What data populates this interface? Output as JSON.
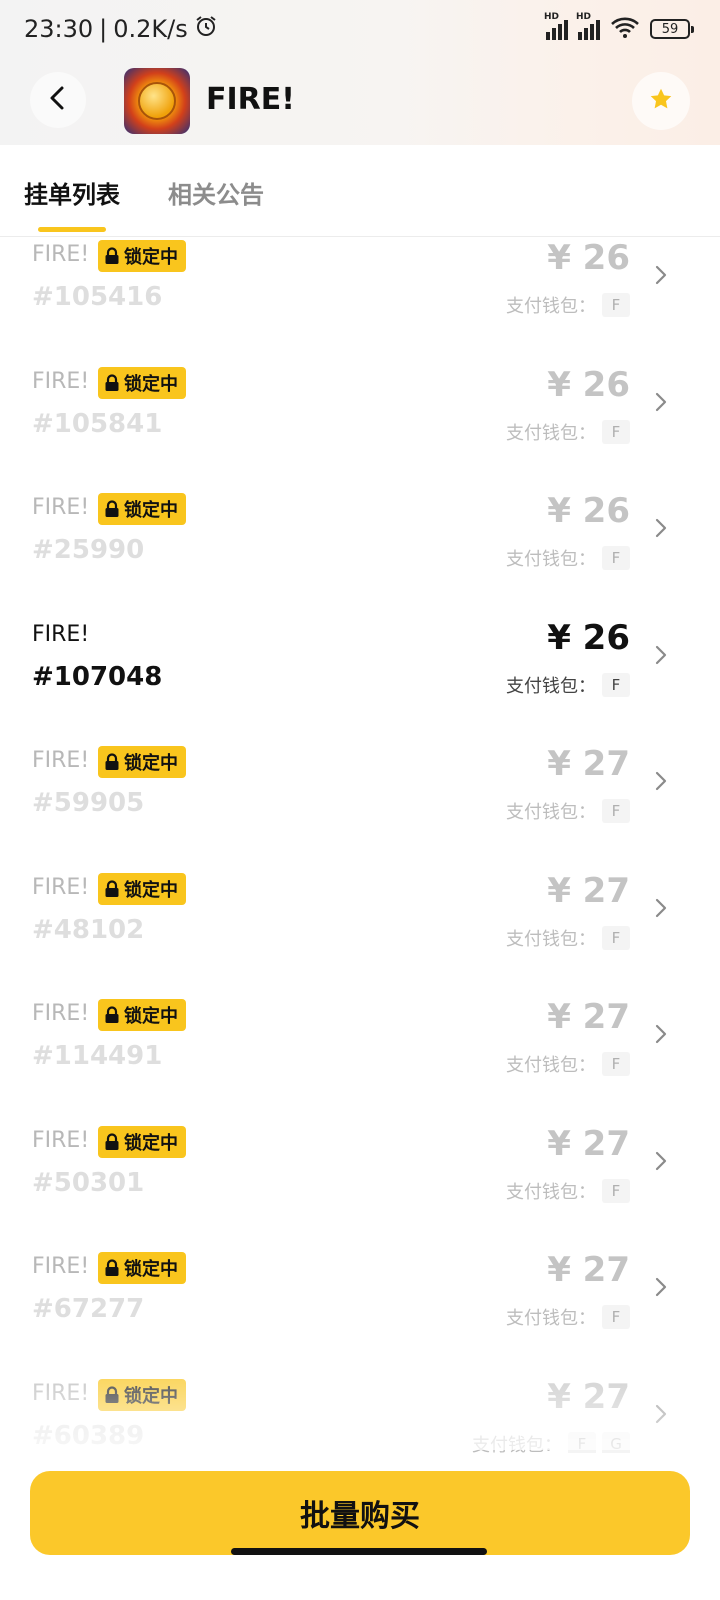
{
  "status_bar": {
    "time": "23:30",
    "separator": "|",
    "net_speed": "0.2K/s",
    "signal_tag": "HD",
    "battery": "59"
  },
  "header": {
    "title": "FIRE!"
  },
  "tabs": [
    {
      "label": "挂单列表",
      "active": true
    },
    {
      "label": "相关公告",
      "active": false
    }
  ],
  "listings": [
    {
      "name": "FIRE!",
      "locked": true,
      "lock_label": "锁定中",
      "code": "#105416",
      "price": "¥ 26",
      "wallet_label": "支付钱包：",
      "wallet_tags": [
        "F"
      ]
    },
    {
      "name": "FIRE!",
      "locked": true,
      "lock_label": "锁定中",
      "code": "#105841",
      "price": "¥ 26",
      "wallet_label": "支付钱包：",
      "wallet_tags": [
        "F"
      ]
    },
    {
      "name": "FIRE!",
      "locked": true,
      "lock_label": "锁定中",
      "code": "#25990",
      "price": "¥ 26",
      "wallet_label": "支付钱包：",
      "wallet_tags": [
        "F"
      ]
    },
    {
      "name": "FIRE!",
      "locked": false,
      "lock_label": "",
      "code": "#107048",
      "price": "¥ 26",
      "wallet_label": "支付钱包：",
      "wallet_tags": [
        "F"
      ]
    },
    {
      "name": "FIRE!",
      "locked": true,
      "lock_label": "锁定中",
      "code": "#59905",
      "price": "¥ 27",
      "wallet_label": "支付钱包：",
      "wallet_tags": [
        "F"
      ]
    },
    {
      "name": "FIRE!",
      "locked": true,
      "lock_label": "锁定中",
      "code": "#48102",
      "price": "¥ 27",
      "wallet_label": "支付钱包：",
      "wallet_tags": [
        "F"
      ]
    },
    {
      "name": "FIRE!",
      "locked": true,
      "lock_label": "锁定中",
      "code": "#114491",
      "price": "¥ 27",
      "wallet_label": "支付钱包：",
      "wallet_tags": [
        "F"
      ]
    },
    {
      "name": "FIRE!",
      "locked": true,
      "lock_label": "锁定中",
      "code": "#50301",
      "price": "¥ 27",
      "wallet_label": "支付钱包：",
      "wallet_tags": [
        "F"
      ]
    },
    {
      "name": "FIRE!",
      "locked": true,
      "lock_label": "锁定中",
      "code": "#67277",
      "price": "¥ 27",
      "wallet_label": "支付钱包：",
      "wallet_tags": [
        "F"
      ]
    },
    {
      "name": "FIRE!",
      "locked": true,
      "lock_label": "锁定中",
      "code": "#60389",
      "price": "¥ 27",
      "wallet_label": "支付钱包：",
      "wallet_tags": [
        "F",
        "G"
      ]
    }
  ],
  "footer": {
    "buy_label": "批量购买"
  },
  "colors": {
    "accent": "#F9C51D",
    "button": "#FBC82A"
  },
  "icons": [
    "back-arrow-icon",
    "app-logo-icon",
    "star-icon",
    "lock-icon",
    "chevron-right-icon",
    "alarm-icon",
    "wifi-icon",
    "battery-icon",
    "signal-icon"
  ]
}
